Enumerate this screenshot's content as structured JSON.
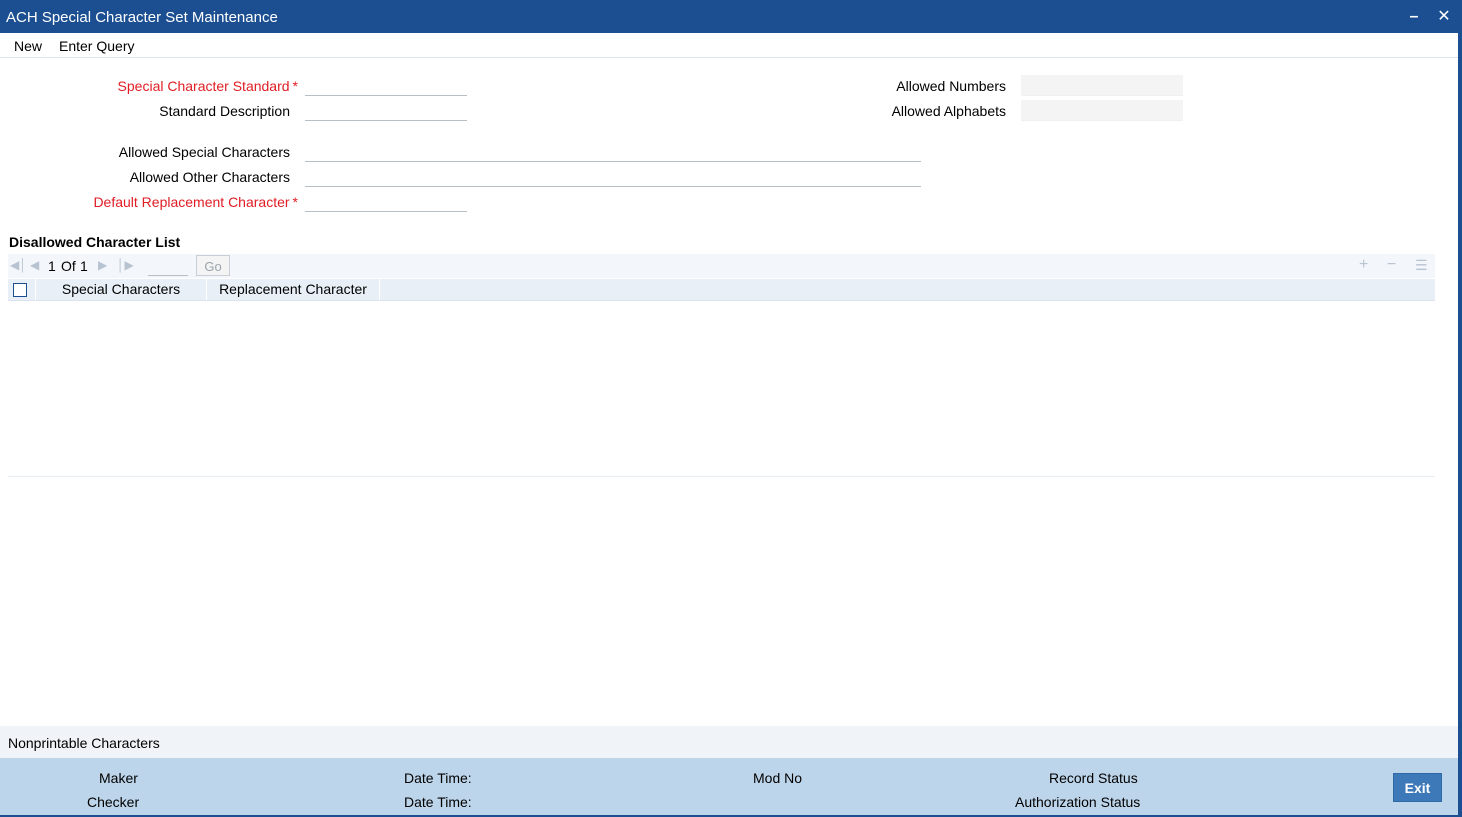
{
  "window": {
    "title": "ACH Special Character Set Maintenance",
    "minimize_glyph": "–",
    "close_glyph": "✕"
  },
  "menu": {
    "new_label": "New",
    "enter_query_label": "Enter Query"
  },
  "form": {
    "special_character_standard": {
      "label": "Special Character Standard",
      "required": "*",
      "value": ""
    },
    "standard_description": {
      "label": "Standard Description",
      "value": ""
    },
    "allowed_numbers": {
      "label": "Allowed Numbers",
      "value": ""
    },
    "allowed_alphabets": {
      "label": "Allowed Alphabets",
      "value": ""
    },
    "allowed_special_characters": {
      "label": "Allowed Special Characters",
      "value": ""
    },
    "allowed_other_characters": {
      "label": "Allowed Other Characters",
      "value": ""
    },
    "default_replacement_character": {
      "label": "Default Replacement Character",
      "required": "*",
      "value": ""
    }
  },
  "grid": {
    "title": "Disallowed Character List",
    "pagination": {
      "current": "1",
      "of_label": "Of",
      "total": "1",
      "go_label": "Go"
    },
    "columns": [
      "Special Characters",
      "Replacement Character"
    ],
    "rows": []
  },
  "nonprintable_label": "Nonprintable Characters",
  "footer": {
    "maker_label": "Maker",
    "checker_label": "Checker",
    "date_time_label_1": "Date Time:",
    "date_time_label_2": "Date Time:",
    "mod_no_label": "Mod No",
    "record_status_label": "Record Status",
    "authorization_status_label": "Authorization Status",
    "exit_label": "Exit"
  },
  "colors": {
    "title_bar": "#1b4f91",
    "required_text": "#e01d24",
    "footer_bg": "#bdd5ea",
    "exit_button": "#3d79b8"
  }
}
